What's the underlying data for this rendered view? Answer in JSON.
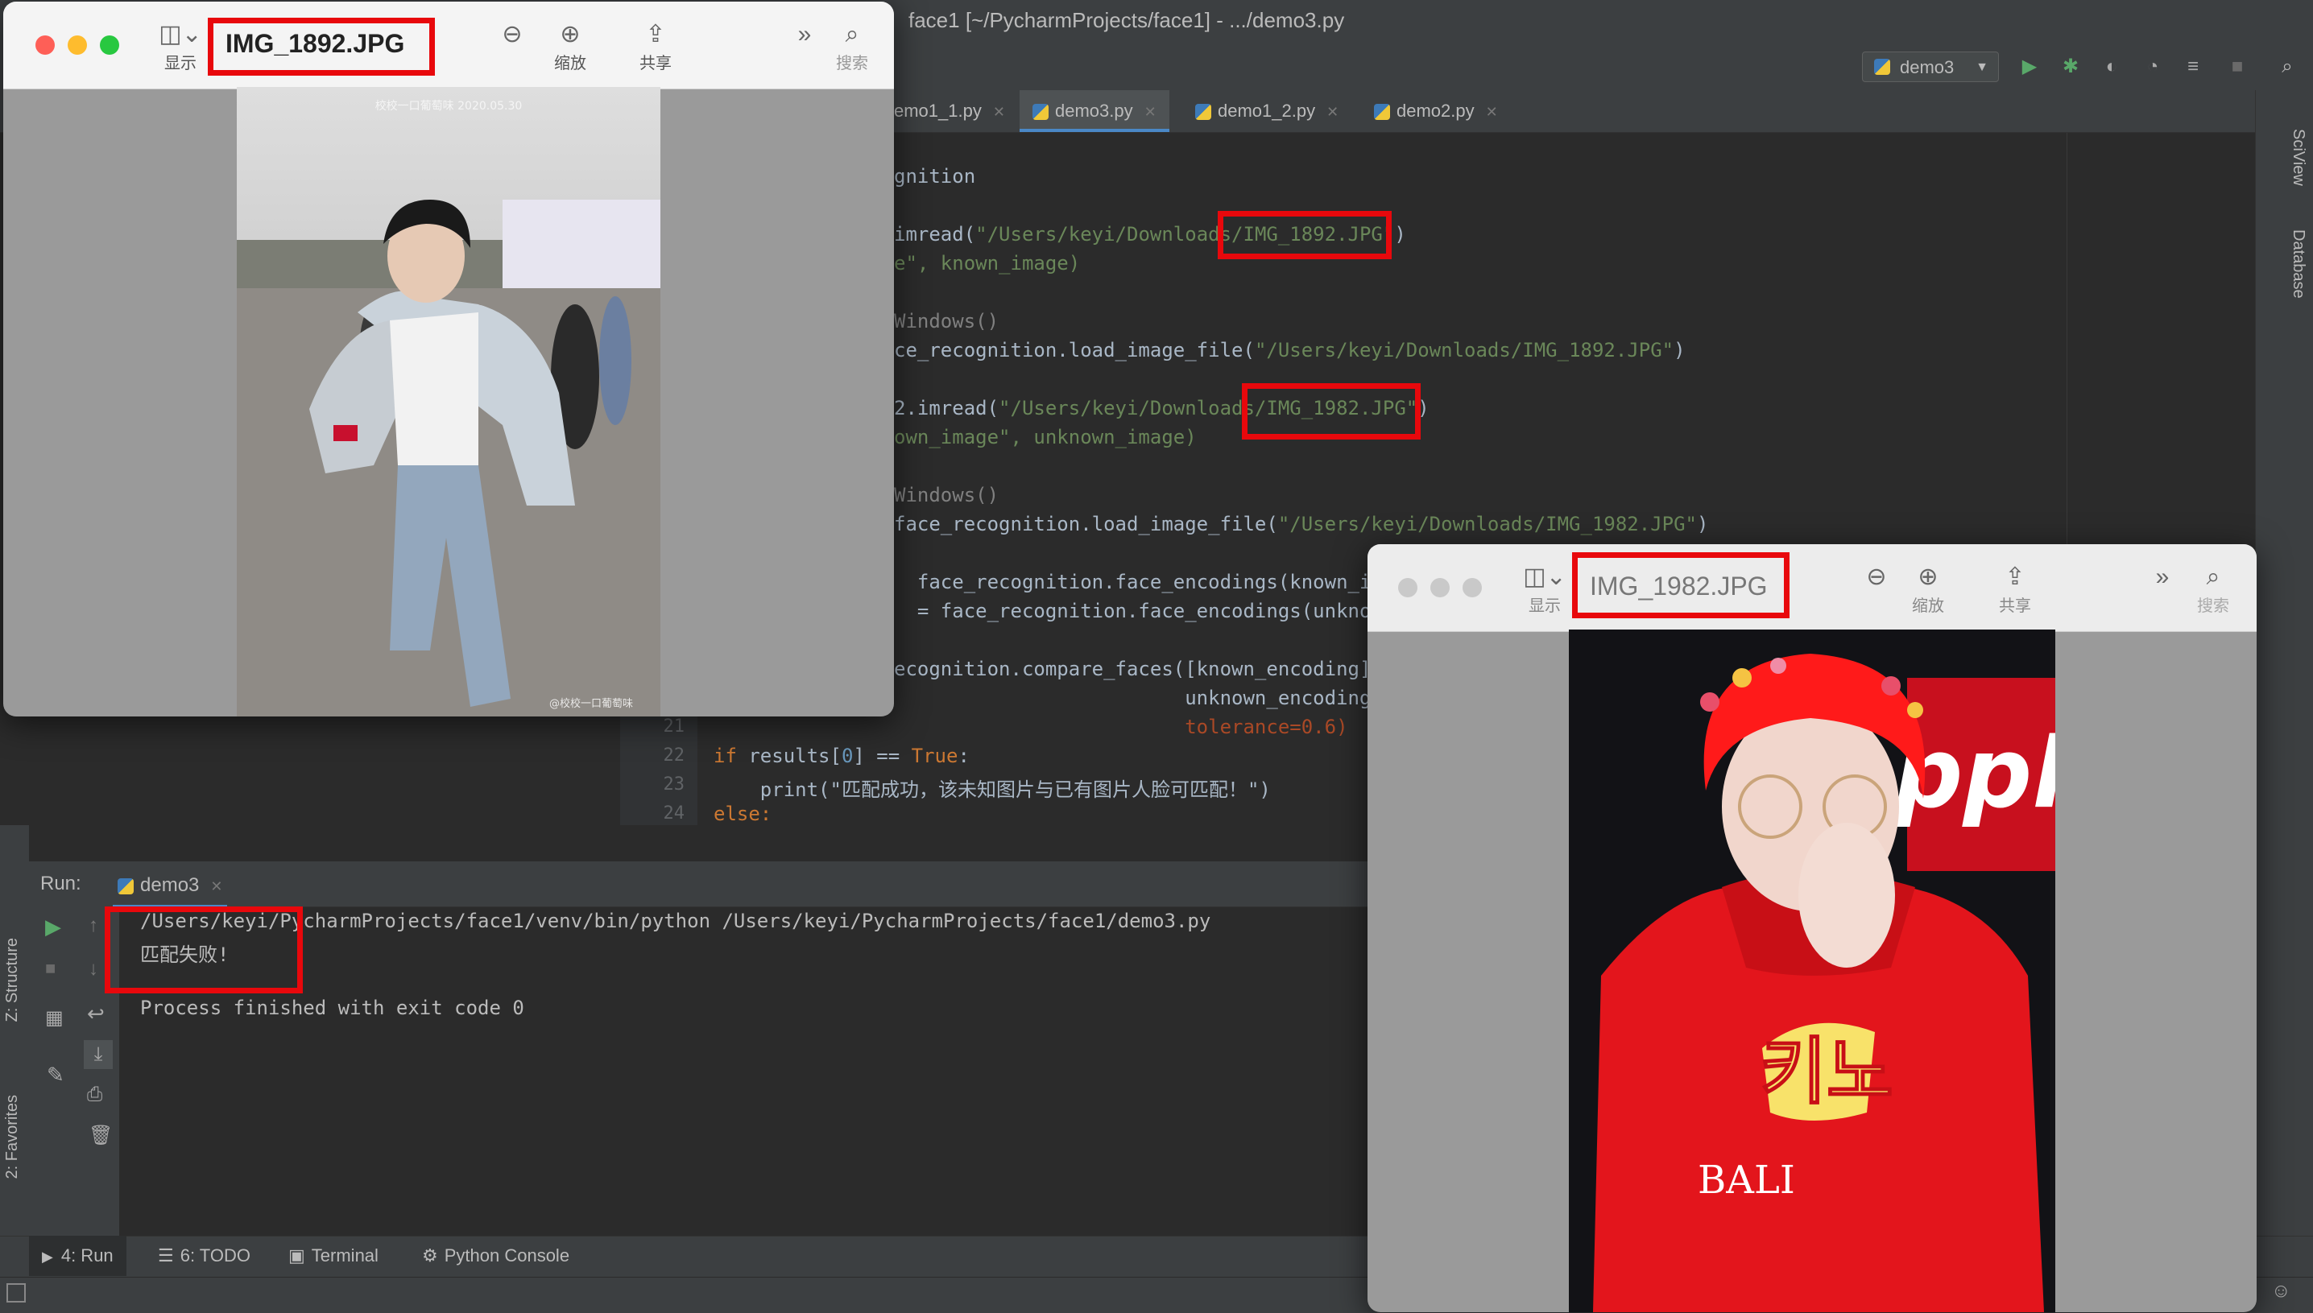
{
  "ide": {
    "window_title": "face1 [~/PycharmProjects/face1] - .../demo3.py",
    "run_config": "demo3",
    "tabs": [
      "emo1_1.py",
      "demo3.py",
      "demo1_2.py",
      "demo2.py"
    ],
    "right_tools": [
      "SciView",
      "Database"
    ],
    "left_tools": [
      "Z: Structure",
      "2: Favorites"
    ],
    "code": [
      {
        "ln": "",
        "text": "gnition"
      },
      {
        "ln": "",
        "pre": "imread(",
        "str": "\"/Users/keyi/Downloads/IMG_1892.JPG\"",
        "post": ")"
      },
      {
        "ln": "",
        "pre": "e\", known_image)",
        "str": "",
        "post": ""
      },
      {
        "ln": "",
        "text": "Windows()"
      },
      {
        "ln": "",
        "pre": "ce_recognition.load_image_file(",
        "str": "\"/Users/keyi/Downloads/IMG_1892.JPG\"",
        "post": ")"
      },
      {
        "ln": "",
        "pre": "2.imread(",
        "str": "\"/Users/keyi/Downloads/IMG_1982.JPG\"",
        "post": ")"
      },
      {
        "ln": "",
        "pre": "own_image\", unknown_image)",
        "str": "",
        "post": ""
      },
      {
        "ln": "",
        "text": "Windows()"
      },
      {
        "ln": "",
        "pre": "face_recognition.load_image_file(",
        "str": "\"/Users/keyi/Downloads/IMG_1982.JPG\"",
        "post": ")"
      },
      {
        "ln": "",
        "text": "  face_recognition.face_encodings(known_ima"
      },
      {
        "ln": "",
        "text": "  = face_recognition.face_encodings(unknown"
      },
      {
        "ln": "",
        "text": "ecognition.compare_faces([known_encoding],"
      },
      {
        "ln": "",
        "text": "                         unknown_encoding,"
      },
      {
        "ln": "21",
        "text": "                         tolerance=0.6)"
      },
      {
        "ln": "22",
        "text": "if results[0] == True:"
      },
      {
        "ln": "23",
        "text": "    print(\"匹配成功，该未知图片与已有图片人脸可匹配！\")"
      },
      {
        "ln": "24",
        "text": "else:"
      }
    ],
    "run": {
      "label": "Run:",
      "tab": "demo3",
      "lines": [
        "/Users/keyi/PycharmProjects/face1/venv/bin/python /Users/keyi/PycharmProjects/face1/demo3.py",
        "匹配失败!",
        "",
        "Process finished with exit code 0"
      ]
    },
    "bottom_tools": [
      {
        "label": "4: Run"
      },
      {
        "label": "6: TODO"
      },
      {
        "label": "Terminal"
      },
      {
        "label": "Python Console"
      }
    ]
  },
  "preview1": {
    "filename": "IMG_1892.JPG",
    "tools": {
      "view": "显示",
      "zoom": "缩放",
      "share": "共享",
      "search": "搜索"
    },
    "photo_watermark_top": "校校一口葡萄味 2020.05.30",
    "photo_watermark_bottom": "@校校一口葡萄味"
  },
  "preview2": {
    "filename": "IMG_1982.JPG",
    "tools": {
      "view": "显示",
      "zoom": "缩放",
      "share": "共享",
      "search": "搜索"
    },
    "photo_text": "키노",
    "photo_shirt_text": "BALI",
    "photo_bg_text": "ppl"
  },
  "colors": {
    "highlight": "#e8080c",
    "ide_bg": "#2b2b2b"
  }
}
